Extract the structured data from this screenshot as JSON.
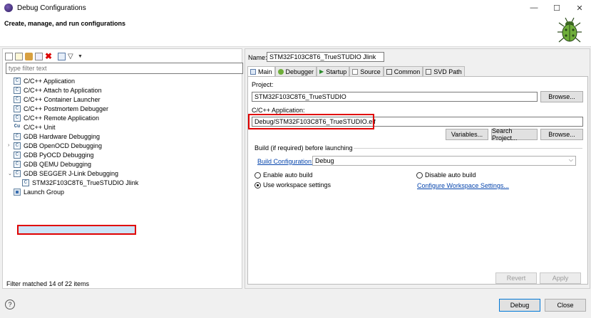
{
  "window": {
    "title": "Debug Configurations",
    "minimize": "—",
    "maximize": "☐",
    "close": "✕"
  },
  "header": {
    "title": "Create, manage, and run configurations"
  },
  "left": {
    "filter_placeholder": "type filter text",
    "tree": [
      {
        "label": "C/C++ Application",
        "icon": "c-icon"
      },
      {
        "label": "C/C++ Attach to Application",
        "icon": "c-icon"
      },
      {
        "label": "C/C++ Container Launcher",
        "icon": "c-icon"
      },
      {
        "label": "C/C++ Postmortem Debugger",
        "icon": "c-icon"
      },
      {
        "label": "C/C++ Remote Application",
        "icon": "c-icon"
      },
      {
        "label": "C/C++ Unit",
        "icon": "cu-icon"
      },
      {
        "label": "GDB Hardware Debugging",
        "icon": "c-icon"
      },
      {
        "label": "GDB OpenOCD Debugging",
        "icon": "c-icon",
        "expander": "›"
      },
      {
        "label": "GDB PyOCD Debugging",
        "icon": "c-icon"
      },
      {
        "label": "GDB QEMU Debugging",
        "icon": "c-icon"
      },
      {
        "label": "GDB SEGGER J-Link Debugging",
        "icon": "c-icon",
        "expander": "⌄"
      },
      {
        "label": "STM32F103C8T6_TrueSTUDIO Jlink",
        "icon": "c-icon"
      },
      {
        "label": "Launch Group",
        "icon": "launch-group-icon"
      }
    ],
    "status": "Filter matched 14 of 22 items"
  },
  "right": {
    "name_label": "Name:",
    "name_value": "STM32F103C8T6_TrueSTUDIO Jlink",
    "tabs": [
      "Main",
      "Debugger",
      "Startup",
      "Source",
      "Common",
      "SVD Path"
    ],
    "project_label": "Project:",
    "project_value": "STM32F103C8T6_TrueSTUDIO",
    "browse1": "Browse...",
    "app_label": "C/C++ Application:",
    "app_value": "Debug/STM32F103C8T6_TrueSTUDIO.elf",
    "variables": "Variables...",
    "search_project": "Search Project...",
    "browse2": "Browse...",
    "build_group": "Build (if required) before launching",
    "build_config_link": "Build Configuration:",
    "build_config_value": "Debug",
    "enable_auto_build": "Enable auto build",
    "disable_auto_build": "Disable auto build",
    "use_workspace": "Use workspace settings",
    "configure_workspace": "Configure Workspace Settings...",
    "revert": "Revert",
    "apply": "Apply"
  },
  "footer": {
    "help": "?",
    "debug": "Debug",
    "close": "Close"
  },
  "colors": {
    "highlight": "#e00000",
    "link": "#0645ad",
    "selection": "#cde3f7"
  }
}
